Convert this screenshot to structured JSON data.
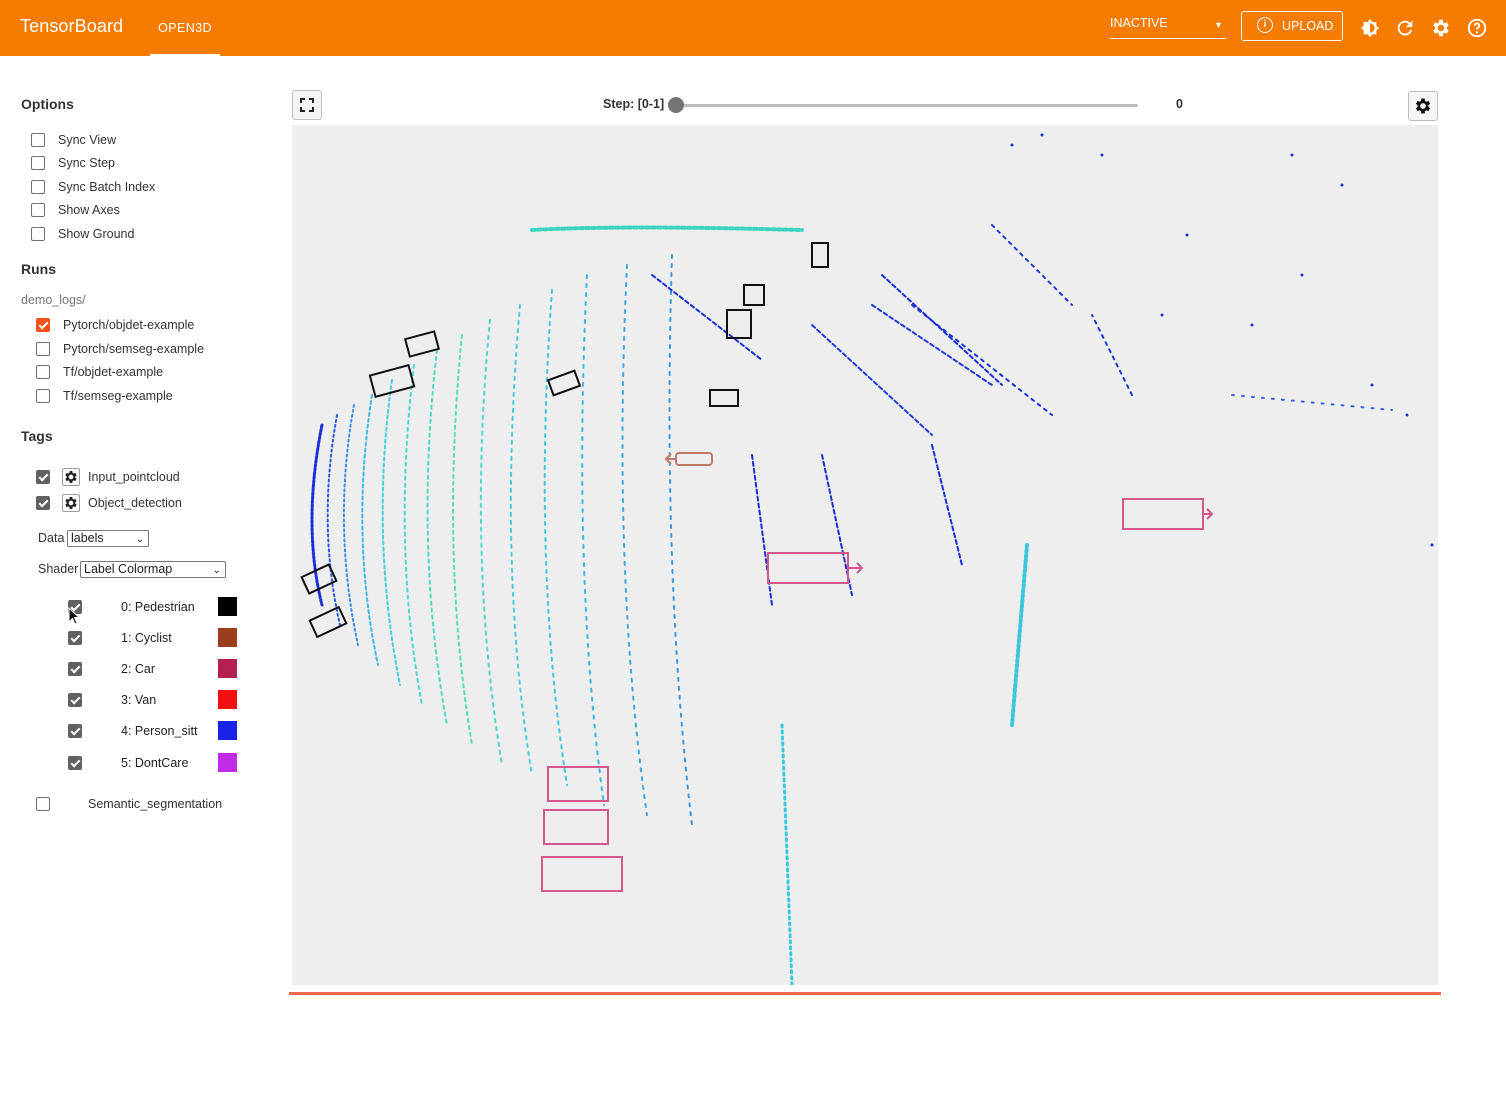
{
  "app": {
    "brand": "TensorBoard",
    "active_tab": "OPEN3D",
    "status": "INACTIVE",
    "upload_label": "UPLOAD"
  },
  "colors": {
    "appbar": "#f57c00",
    "run_checked": "#f4511e",
    "canvas_bg": "#eeeeee"
  },
  "toolbar_icons": [
    "brightness-icon",
    "refresh-icon",
    "settings-gear-icon",
    "help-icon"
  ],
  "options": {
    "title": "Options",
    "items": [
      {
        "label": "Sync View",
        "checked": false
      },
      {
        "label": "Sync Step",
        "checked": false
      },
      {
        "label": "Sync Batch Index",
        "checked": false
      },
      {
        "label": "Show Axes",
        "checked": false
      },
      {
        "label": "Show Ground",
        "checked": false
      }
    ]
  },
  "runs": {
    "title": "Runs",
    "prefix": "demo_logs/",
    "items": [
      {
        "label": "Pytorch/objdet-example",
        "checked": true
      },
      {
        "label": "Pytorch/semseg-example",
        "checked": false
      },
      {
        "label": "Tf/objdet-example",
        "checked": false
      },
      {
        "label": "Tf/semseg-example",
        "checked": false
      }
    ]
  },
  "tags": {
    "title": "Tags",
    "items": [
      {
        "label": "Input_pointcloud",
        "checked": true
      },
      {
        "label": "Object_detection",
        "checked": true
      }
    ],
    "data_label": "Data",
    "data_value": "labels",
    "shader_label": "Shader",
    "shader_value": "Label Colormap",
    "labels": [
      {
        "name": "0: Pedestrian",
        "color": "#000000",
        "checked": true
      },
      {
        "name": "1: Cyclist",
        "color": "#9c3d1f",
        "checked": true
      },
      {
        "name": "2: Car",
        "color": "#b4204f",
        "checked": true
      },
      {
        "name": "3: Van",
        "color": "#f20f0f",
        "checked": true
      },
      {
        "name": "4: Person_sitt",
        "color": "#1a22e8",
        "checked": true
      },
      {
        "name": "5: DontCare",
        "color": "#c02ce6",
        "checked": true
      }
    ],
    "semantic": {
      "label": "Semantic_segmentation",
      "checked": false
    }
  },
  "viewer": {
    "step_label": "Step: [0-1]",
    "step_value": "0",
    "step_min": 0,
    "step_max": 1,
    "step_current": 0
  }
}
